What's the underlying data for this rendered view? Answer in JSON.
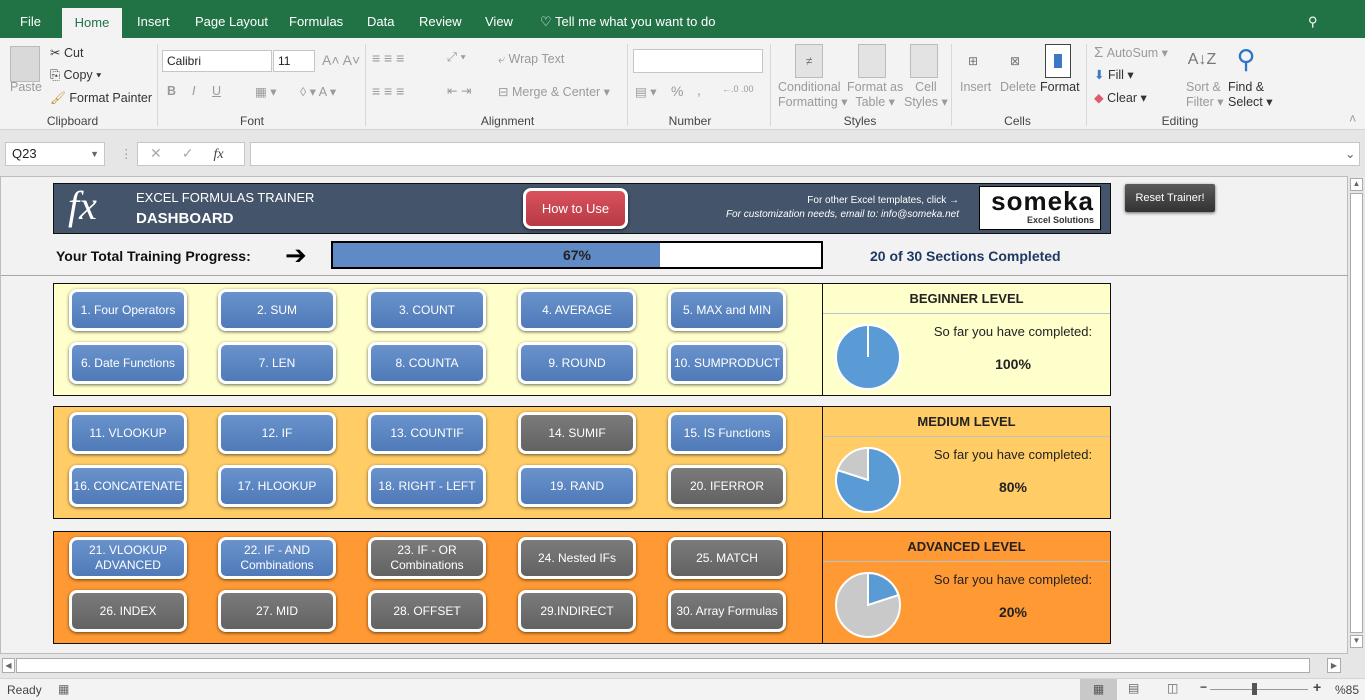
{
  "ribbon_tabs": [
    "File",
    "Home",
    "Insert",
    "Page Layout",
    "Formulas",
    "Data",
    "Review",
    "View"
  ],
  "active_tab": "Home",
  "tell_me": "Tell me what you want to do",
  "share": "Share",
  "clipboard": {
    "paste": "Paste",
    "cut": "Cut",
    "copy": "Copy",
    "format_painter": "Format Painter",
    "label": "Clipboard"
  },
  "font": {
    "name": "Calibri",
    "size": "11",
    "bold": "B",
    "italic": "I",
    "underline": "U",
    "label": "Font"
  },
  "alignment": {
    "wrap": "Wrap Text",
    "merge": "Merge & Center",
    "label": "Alignment"
  },
  "number": {
    "format": "",
    "percent": "%",
    "comma": ",",
    "label": "Number"
  },
  "styles": {
    "conditional": "Conditional",
    "conditional2": "Formatting",
    "format_table": "Format as",
    "format_table2": "Table",
    "cell_styles": "Cell",
    "cell_styles2": "Styles",
    "label": "Styles"
  },
  "cells": {
    "insert": "Insert",
    "delete": "Delete",
    "format": "Format",
    "label": "Cells"
  },
  "editing": {
    "autosum": "AutoSum",
    "fill": "Fill",
    "clear": "Clear",
    "sort": "Sort &",
    "sort2": "Filter",
    "find": "Find &",
    "find2": "Select",
    "label": "Editing"
  },
  "name_box": "Q23",
  "formula": "",
  "fx": "fx",
  "dashboard": {
    "subtitle": "EXCEL FORMULAS TRAINER",
    "title": "DASHBOARD",
    "how_to_use": "How to Use",
    "other_templates": "For other Excel templates, click →",
    "customization": "For customization needs, email to: info@someka.net",
    "logo": "someka",
    "logo_sub": "Excel Solutions",
    "reset": "Reset Trainer!",
    "progress_label": "Your Total Training Progress:",
    "progress_value": 0.67,
    "progress_text": "67%",
    "sections_completed": "20 of 30 Sections Completed"
  },
  "levels": [
    {
      "name": "BEGINNER LEVEL",
      "completed_label": "So far you have completed:",
      "percent_text": "100%",
      "fraction": 1.0,
      "bg": "#ffffcc",
      "buttons": [
        {
          "label": "1. Four Operators",
          "done": true
        },
        {
          "label": "2. SUM",
          "done": true
        },
        {
          "label": "3. COUNT",
          "done": true
        },
        {
          "label": "4. AVERAGE",
          "done": true
        },
        {
          "label": "5. MAX and MIN",
          "done": true
        },
        {
          "label": "6. Date Functions",
          "done": true
        },
        {
          "label": "7. LEN",
          "done": true
        },
        {
          "label": "8. COUNTA",
          "done": true
        },
        {
          "label": "9. ROUND",
          "done": true
        },
        {
          "label": "10. SUMPRODUCT",
          "done": true
        }
      ]
    },
    {
      "name": "MEDIUM LEVEL",
      "completed_label": "So far you have completed:",
      "percent_text": "80%",
      "fraction": 0.8,
      "bg": "#ffcc66",
      "buttons": [
        {
          "label": "11. VLOOKUP",
          "done": true
        },
        {
          "label": "12. IF",
          "done": true
        },
        {
          "label": "13. COUNTIF",
          "done": true
        },
        {
          "label": "14. SUMIF",
          "done": false
        },
        {
          "label": "15. IS Functions",
          "done": true
        },
        {
          "label": "16. CONCATENATE",
          "done": true
        },
        {
          "label": "17. HLOOKUP",
          "done": true
        },
        {
          "label": "18. RIGHT - LEFT",
          "done": true
        },
        {
          "label": "19. RAND",
          "done": true
        },
        {
          "label": "20. IFERROR",
          "done": false
        }
      ]
    },
    {
      "name": "ADVANCED LEVEL",
      "completed_label": "So far you have completed:",
      "percent_text": "20%",
      "fraction": 0.2,
      "bg": "#ff9933",
      "buttons": [
        {
          "label": "21. VLOOKUP ADVANCED",
          "done": true
        },
        {
          "label": "22. IF - AND Combinations",
          "done": true
        },
        {
          "label": "23. IF - OR Combinations",
          "done": false
        },
        {
          "label": "24. Nested IFs",
          "done": false
        },
        {
          "label": "25. MATCH",
          "done": false
        },
        {
          "label": "26. INDEX",
          "done": false
        },
        {
          "label": "27. MID",
          "done": false
        },
        {
          "label": "28. OFFSET",
          "done": false
        },
        {
          "label": "29.INDIRECT",
          "done": false
        },
        {
          "label": "30. Array Formulas",
          "done": false
        }
      ]
    }
  ],
  "status": {
    "ready": "Ready",
    "zoom": "%85",
    "zoom_fraction": 0.45
  }
}
